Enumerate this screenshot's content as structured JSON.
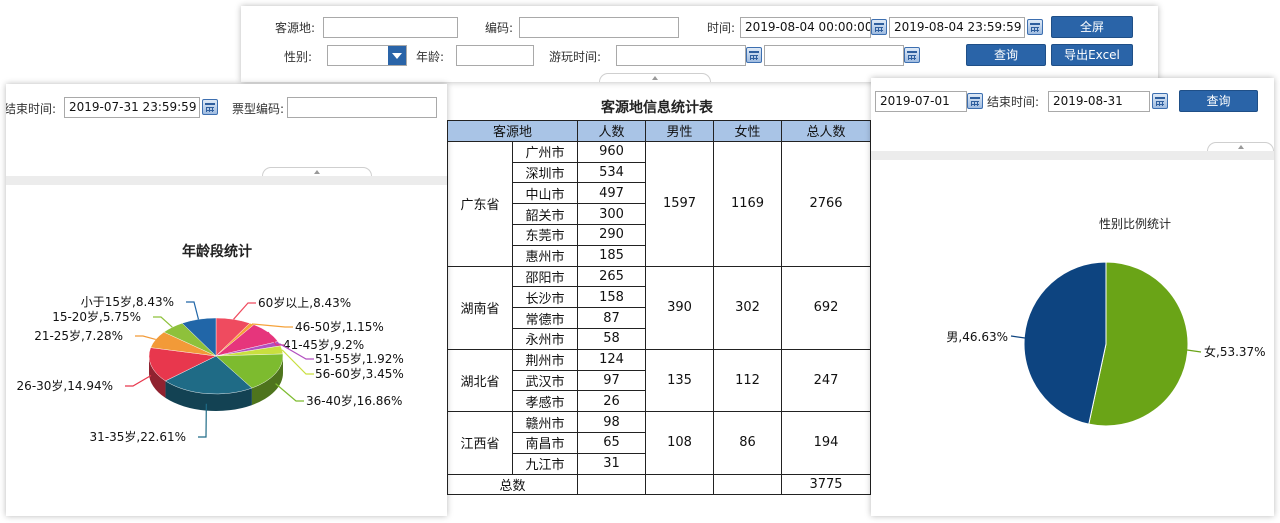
{
  "top_form": {
    "source_label": "客源地:",
    "code_label": "编码:",
    "time_label": "时间:",
    "time_start": "2019-08-04 00:00:00",
    "time_end": "2019-08-04 23:59:59",
    "fullscreen_button": "全屏",
    "gender_label": "性别:",
    "age_label": "年龄:",
    "play_time_label": "游玩时间:",
    "query_button": "查询",
    "export_button": "导出Excel"
  },
  "left_form": {
    "end_time_label": "结束时间:",
    "end_time_value": "2019-07-31 23:59:59",
    "ticket_code_label": "票型编码:"
  },
  "right_form": {
    "start_date_value": "2019-07-01",
    "end_time_label": "结束时间:",
    "end_date_value": "2019-08-31",
    "query_button": "查询"
  },
  "table": {
    "title": "客源地信息统计表",
    "headers": [
      "客源地",
      "人数",
      "男性",
      "女性",
      "总人数"
    ],
    "groups": [
      {
        "province": "广东省",
        "male": "1597",
        "female": "1169",
        "total": "2766",
        "cities": [
          [
            "广州市",
            "960"
          ],
          [
            "深圳市",
            "534"
          ],
          [
            "中山市",
            "497"
          ],
          [
            "韶关市",
            "300"
          ],
          [
            "东莞市",
            "290"
          ],
          [
            "惠州市",
            "185"
          ]
        ]
      },
      {
        "province": "湖南省",
        "male": "390",
        "female": "302",
        "total": "692",
        "cities": [
          [
            "邵阳市",
            "265"
          ],
          [
            "长沙市",
            "158"
          ],
          [
            "常德市",
            "87"
          ],
          [
            "永州市",
            "58"
          ]
        ]
      },
      {
        "province": "湖北省",
        "male": "135",
        "female": "112",
        "total": "247",
        "cities": [
          [
            "荆州市",
            "124"
          ],
          [
            "武汉市",
            "97"
          ],
          [
            "孝感市",
            "26"
          ]
        ]
      },
      {
        "province": "江西省",
        "male": "108",
        "female": "86",
        "total": "194",
        "cities": [
          [
            "赣州市",
            "98"
          ],
          [
            "南昌市",
            "65"
          ],
          [
            "九江市",
            "31"
          ]
        ]
      }
    ],
    "total_label": "总数",
    "grand_total": "3775"
  },
  "chart_data": [
    {
      "type": "pie",
      "title": "年龄段统计",
      "slices": [
        {
          "label": "60岁以上",
          "value": 8.43,
          "display": "60岁以上,8.43%",
          "color": "#ef4b5f"
        },
        {
          "label": "46-50岁",
          "value": 1.15,
          "display": "46-50岁,1.15%",
          "color": "#f5a23a"
        },
        {
          "label": "41-45岁",
          "value": 9.2,
          "display": "41-45岁,9.2%",
          "color": "#e6357c"
        },
        {
          "label": "51-55岁",
          "value": 1.92,
          "display": "51-55岁,1.92%",
          "color": "#b24fc0"
        },
        {
          "label": "56-60岁",
          "value": 3.45,
          "display": "56-60岁,3.45%",
          "color": "#c9df3f"
        },
        {
          "label": "36-40岁",
          "value": 16.86,
          "display": "36-40岁,16.86%",
          "color": "#7dbb2f"
        },
        {
          "label": "31-35岁",
          "value": 22.61,
          "display": "31-35岁,22.61%",
          "color": "#1f6b86"
        },
        {
          "label": "26-30岁",
          "value": 14.94,
          "display": "26-30岁,14.94%",
          "color": "#e8374d"
        },
        {
          "label": "21-25岁",
          "value": 7.28,
          "display": "21-25岁,7.28%",
          "color": "#f29a38"
        },
        {
          "label": "15-20岁",
          "value": 5.75,
          "display": "15-20岁,5.75%",
          "color": "#8ec13b"
        },
        {
          "label": "小于15岁",
          "value": 8.43,
          "display": "小于15岁,8.43%",
          "color": "#2166a8"
        }
      ]
    },
    {
      "type": "pie",
      "title": "性别比例统计",
      "slices": [
        {
          "label": "女",
          "value": 53.37,
          "display": "女,53.37%",
          "color": "#6aa417"
        },
        {
          "label": "男",
          "value": 46.63,
          "display": "男,46.63%",
          "color": "#0d4480"
        }
      ]
    }
  ]
}
